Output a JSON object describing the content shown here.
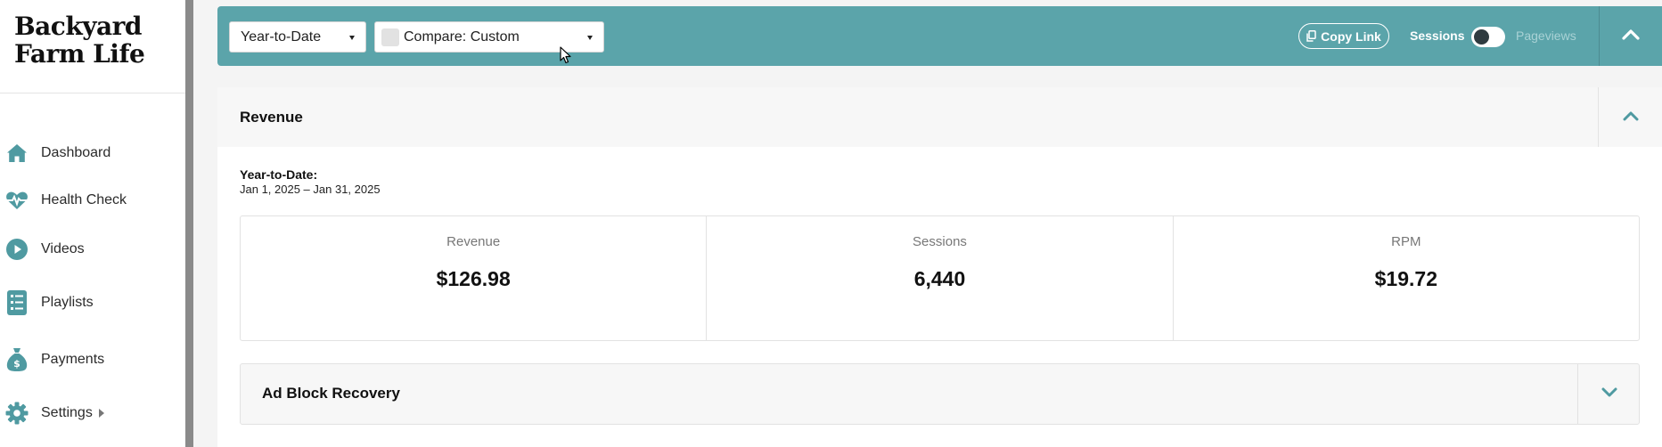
{
  "brand": {
    "line1": "Backyard",
    "line2": "Farm Life"
  },
  "sidebar": {
    "items": [
      {
        "label": "Dashboard",
        "icon": "home-icon"
      },
      {
        "label": "Health Check",
        "icon": "heartbeat-icon"
      },
      {
        "label": "Videos",
        "icon": "play-circle-icon"
      },
      {
        "label": "Playlists",
        "icon": "list-icon"
      },
      {
        "label": "Payments",
        "icon": "money-bag-icon"
      },
      {
        "label": "Settings",
        "icon": "gear-icon"
      }
    ]
  },
  "toolbar": {
    "period_select": "Year-to-Date",
    "compare_select": "Compare: Custom",
    "copy_link": "Copy Link",
    "toggle_left": "Sessions",
    "toggle_right": "Pageviews"
  },
  "revenue": {
    "title": "Revenue",
    "period_title": "Year-to-Date:",
    "period_range": "Jan 1, 2025 – Jan 31, 2025",
    "stats": [
      {
        "label": "Revenue",
        "value": "$126.98"
      },
      {
        "label": "Sessions",
        "value": "6,440"
      },
      {
        "label": "RPM",
        "value": "$19.72"
      }
    ]
  },
  "ad_block": {
    "title": "Ad Block Recovery"
  },
  "colors": {
    "accent": "#5ba4aa",
    "icon": "#4f9aa1",
    "text": "#1a1a1a"
  }
}
